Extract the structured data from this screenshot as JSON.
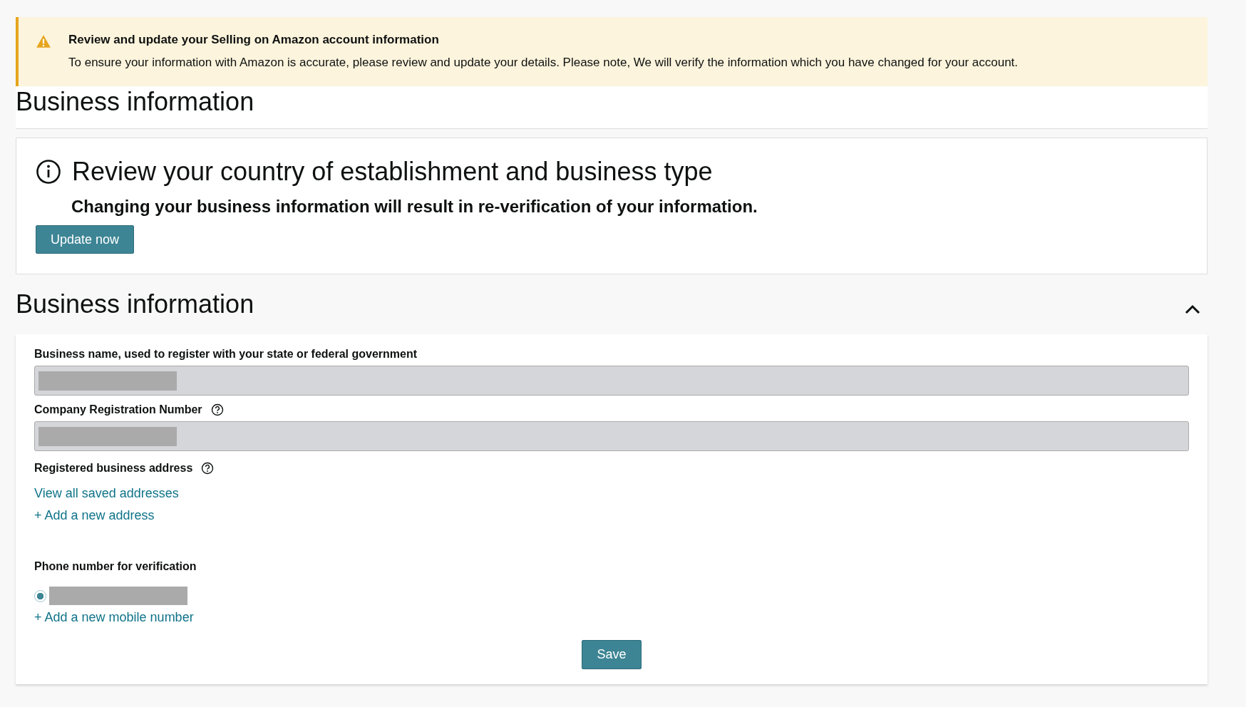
{
  "alert": {
    "kind": "warning",
    "title": "Review and update your Selling on Amazon account information",
    "message": "To ensure your information with Amazon is accurate, please review and update your details. Please note, We will verify the information which you have changed for your account."
  },
  "page_heading": "Business information",
  "notice": {
    "title": "Review your country of establishment and business type",
    "subtitle": "Changing your business information will result in re-verification of your information.",
    "button": "Update now"
  },
  "section": {
    "title": "Business information",
    "expanded": true,
    "fields": [
      {
        "label": "Business name, used to register with your state or federal government",
        "help": false,
        "disabled": true
      },
      {
        "label": "Company Registration Number",
        "help": true,
        "disabled": true
      }
    ],
    "address": {
      "label": "Registered business address",
      "help": true,
      "links": [
        "View all saved addresses",
        "+ Add a new address"
      ]
    },
    "phone": {
      "label": "Phone number for verification",
      "options": [
        {
          "selected": true
        }
      ],
      "add_link": "+ Add a new mobile number"
    },
    "save_button": "Save"
  }
}
